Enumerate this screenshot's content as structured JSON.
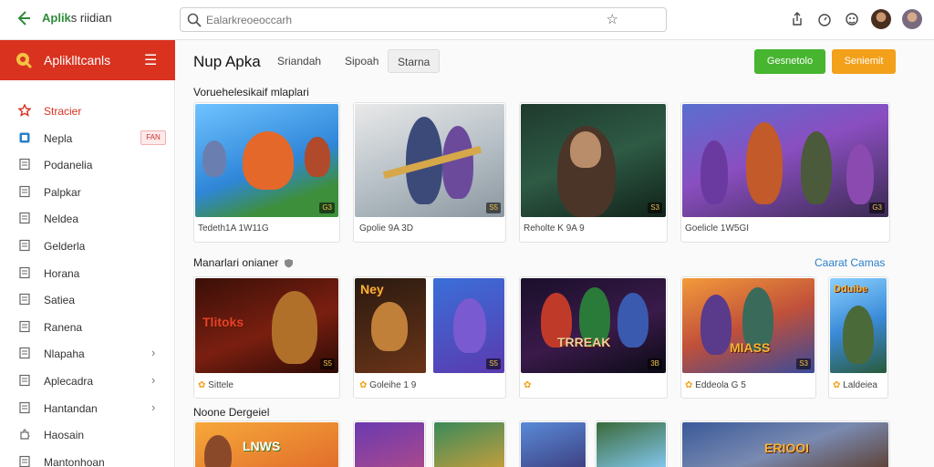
{
  "app": {
    "brand_green": "Aplik",
    "brand_rest": "s riidian"
  },
  "search": {
    "placeholder": "Ealarkreoeoccarh"
  },
  "sidebar": {
    "title": "Apliklltcanls",
    "items": [
      {
        "label": "Stracier",
        "icon": "star-icon",
        "active": true
      },
      {
        "label": "Nepla",
        "icon": "document-icon",
        "badge": "FAN"
      },
      {
        "label": "Podanelia",
        "icon": "page-icon"
      },
      {
        "label": "Palpkar",
        "icon": "page-icon"
      },
      {
        "label": "Neldea",
        "icon": "page-icon"
      },
      {
        "label": "Gelderla",
        "icon": "page-icon"
      },
      {
        "label": "Horana",
        "icon": "page-icon"
      },
      {
        "label": "Satiea",
        "icon": "page-icon"
      },
      {
        "label": "Ranena",
        "icon": "page-icon"
      },
      {
        "label": "Nlapaha",
        "icon": "page-icon",
        "chevron": "›"
      },
      {
        "label": "Aplecadra",
        "icon": "page-icon",
        "chevron": "›"
      },
      {
        "label": "Hantandan",
        "icon": "page-icon",
        "chevron": "›"
      },
      {
        "label": "Haosain",
        "icon": "puzzle-icon"
      },
      {
        "label": "Mantonhoan",
        "icon": "page-icon"
      }
    ]
  },
  "main": {
    "title": "Nup Apka",
    "tabs": [
      "Sriandah",
      "Sipoah",
      "Starna"
    ],
    "buttons": {
      "green": "Gesnetolo",
      "orange": "Seniemit"
    },
    "section1": {
      "title": "Voruehelesikaif mlaplari",
      "cards": [
        {
          "caption": "Tedeth1A 1W11G",
          "badge": "G3"
        },
        {
          "caption": "Gpolie 9A 3D",
          "badge": "S5"
        },
        {
          "caption": "Reholte K 9A 9",
          "badge": "S3"
        },
        {
          "caption": "Goelicle 1W5GI",
          "badge": "G3"
        }
      ]
    },
    "section2": {
      "title": "Manarlari onianer",
      "link": "Caarat Camas",
      "cards": [
        {
          "caption": "Sittele",
          "badge": "S5"
        },
        {
          "caption": "Goleihe 1 9",
          "badge": "S5"
        },
        {
          "caption": "",
          "badge": "3B"
        },
        {
          "caption": "Eddeola G 5",
          "badge": "S3"
        },
        {
          "caption": "Laldeiea",
          "badge": ""
        }
      ]
    },
    "section3": {
      "title": "Noone Dergeiel"
    }
  },
  "colors": {
    "accent_red": "#d9321f",
    "green": "#47b52f",
    "orange": "#f3a01b",
    "link": "#2a7fc9"
  }
}
